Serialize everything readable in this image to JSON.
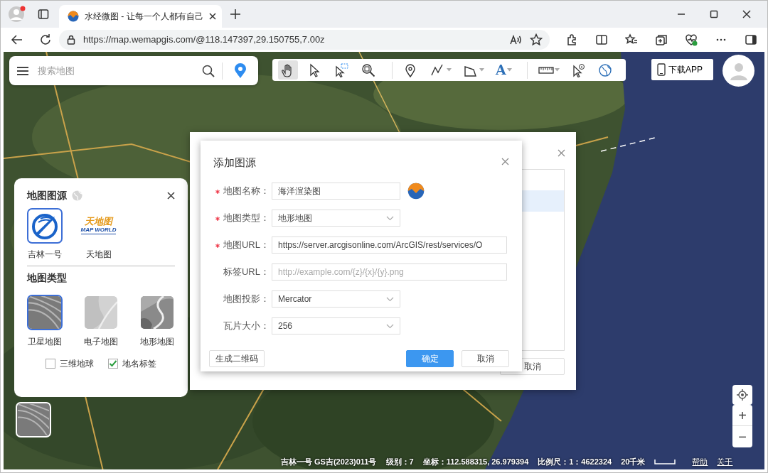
{
  "browser": {
    "tab_title": "水经微图 - 让每一个人都有自己",
    "url": "https://map.wemapgis.com/@118.147397,29.150755,7.00z"
  },
  "search": {
    "placeholder": "搜索地图"
  },
  "toolbar": [
    [
      {
        "kind": "hand",
        "selected": true,
        "dropdown": false
      },
      {
        "kind": "pointer",
        "selected": false,
        "dropdown": false
      },
      {
        "kind": "box-select",
        "selected": false,
        "dropdown": false
      },
      {
        "kind": "zoom-area",
        "selected": false,
        "dropdown": false
      }
    ],
    [
      {
        "kind": "pin",
        "selected": false,
        "dropdown": false
      },
      {
        "kind": "polyline",
        "selected": false,
        "dropdown": true
      },
      {
        "kind": "polygon",
        "selected": false,
        "dropdown": true
      },
      {
        "kind": "text",
        "glyph": "A",
        "selected": false,
        "dropdown": true
      }
    ],
    [
      {
        "kind": "ruler",
        "selected": false,
        "dropdown": true
      },
      {
        "kind": "info-pointer",
        "selected": false,
        "dropdown": false
      },
      {
        "kind": "globe",
        "selected": false,
        "dropdown": false
      }
    ]
  ],
  "download_button": "下载APP",
  "source_panel": {
    "title": "地图图源",
    "sources": [
      {
        "kind": "jilin",
        "label": "吉林一号",
        "selected": true
      },
      {
        "kind": "mapworld",
        "logo": "天地图",
        "logo_sub": "MAP WORLD",
        "label": "天地图",
        "selected": false
      }
    ],
    "types_title": "地图类型",
    "types": [
      {
        "kind": "satellite",
        "label": "卫星地图",
        "selected": true
      },
      {
        "kind": "vector",
        "label": "电子地图",
        "selected": false
      },
      {
        "kind": "terrain",
        "label": "地形地图",
        "selected": false
      }
    ],
    "options": [
      {
        "label": "三维地球",
        "checked": false
      },
      {
        "label": "地名标签",
        "checked": true
      }
    ]
  },
  "back_dialog": {
    "cancel": "取消"
  },
  "dialog": {
    "title": "添加图源",
    "fields": [
      {
        "kind": "text",
        "label": "地图名称：",
        "required": true,
        "value": "海洋渲染图",
        "icon": true
      },
      {
        "kind": "select",
        "label": "地图类型：",
        "required": true,
        "value": "地形地图"
      },
      {
        "kind": "text",
        "label": "地图URL：",
        "required": true,
        "value": "https://server.arcgisonline.com/ArcGIS/rest/services/O",
        "icon": false
      },
      {
        "kind": "text",
        "label": "标签URL：",
        "required": false,
        "placeholder": "http://example.com/{z}/{x}/{y}.png",
        "icon": false
      },
      {
        "kind": "select",
        "label": "地图投影：",
        "required": false,
        "value": "Mercator"
      },
      {
        "kind": "select",
        "label": "瓦片大小：",
        "required": false,
        "value": "256"
      }
    ],
    "qr_button": "生成二维码",
    "ok": "确定",
    "cancel": "取消"
  },
  "zoom": {
    "in": "+",
    "out": "−"
  },
  "status": {
    "source": "吉林一号 GS吉(2023)011号",
    "level": "级别：7",
    "coords": "坐标：112.588315, 26.979394",
    "scale": "比例尺：1：4622324",
    "scale_bar": "20千米",
    "links": [
      "帮助",
      "关于"
    ]
  }
}
